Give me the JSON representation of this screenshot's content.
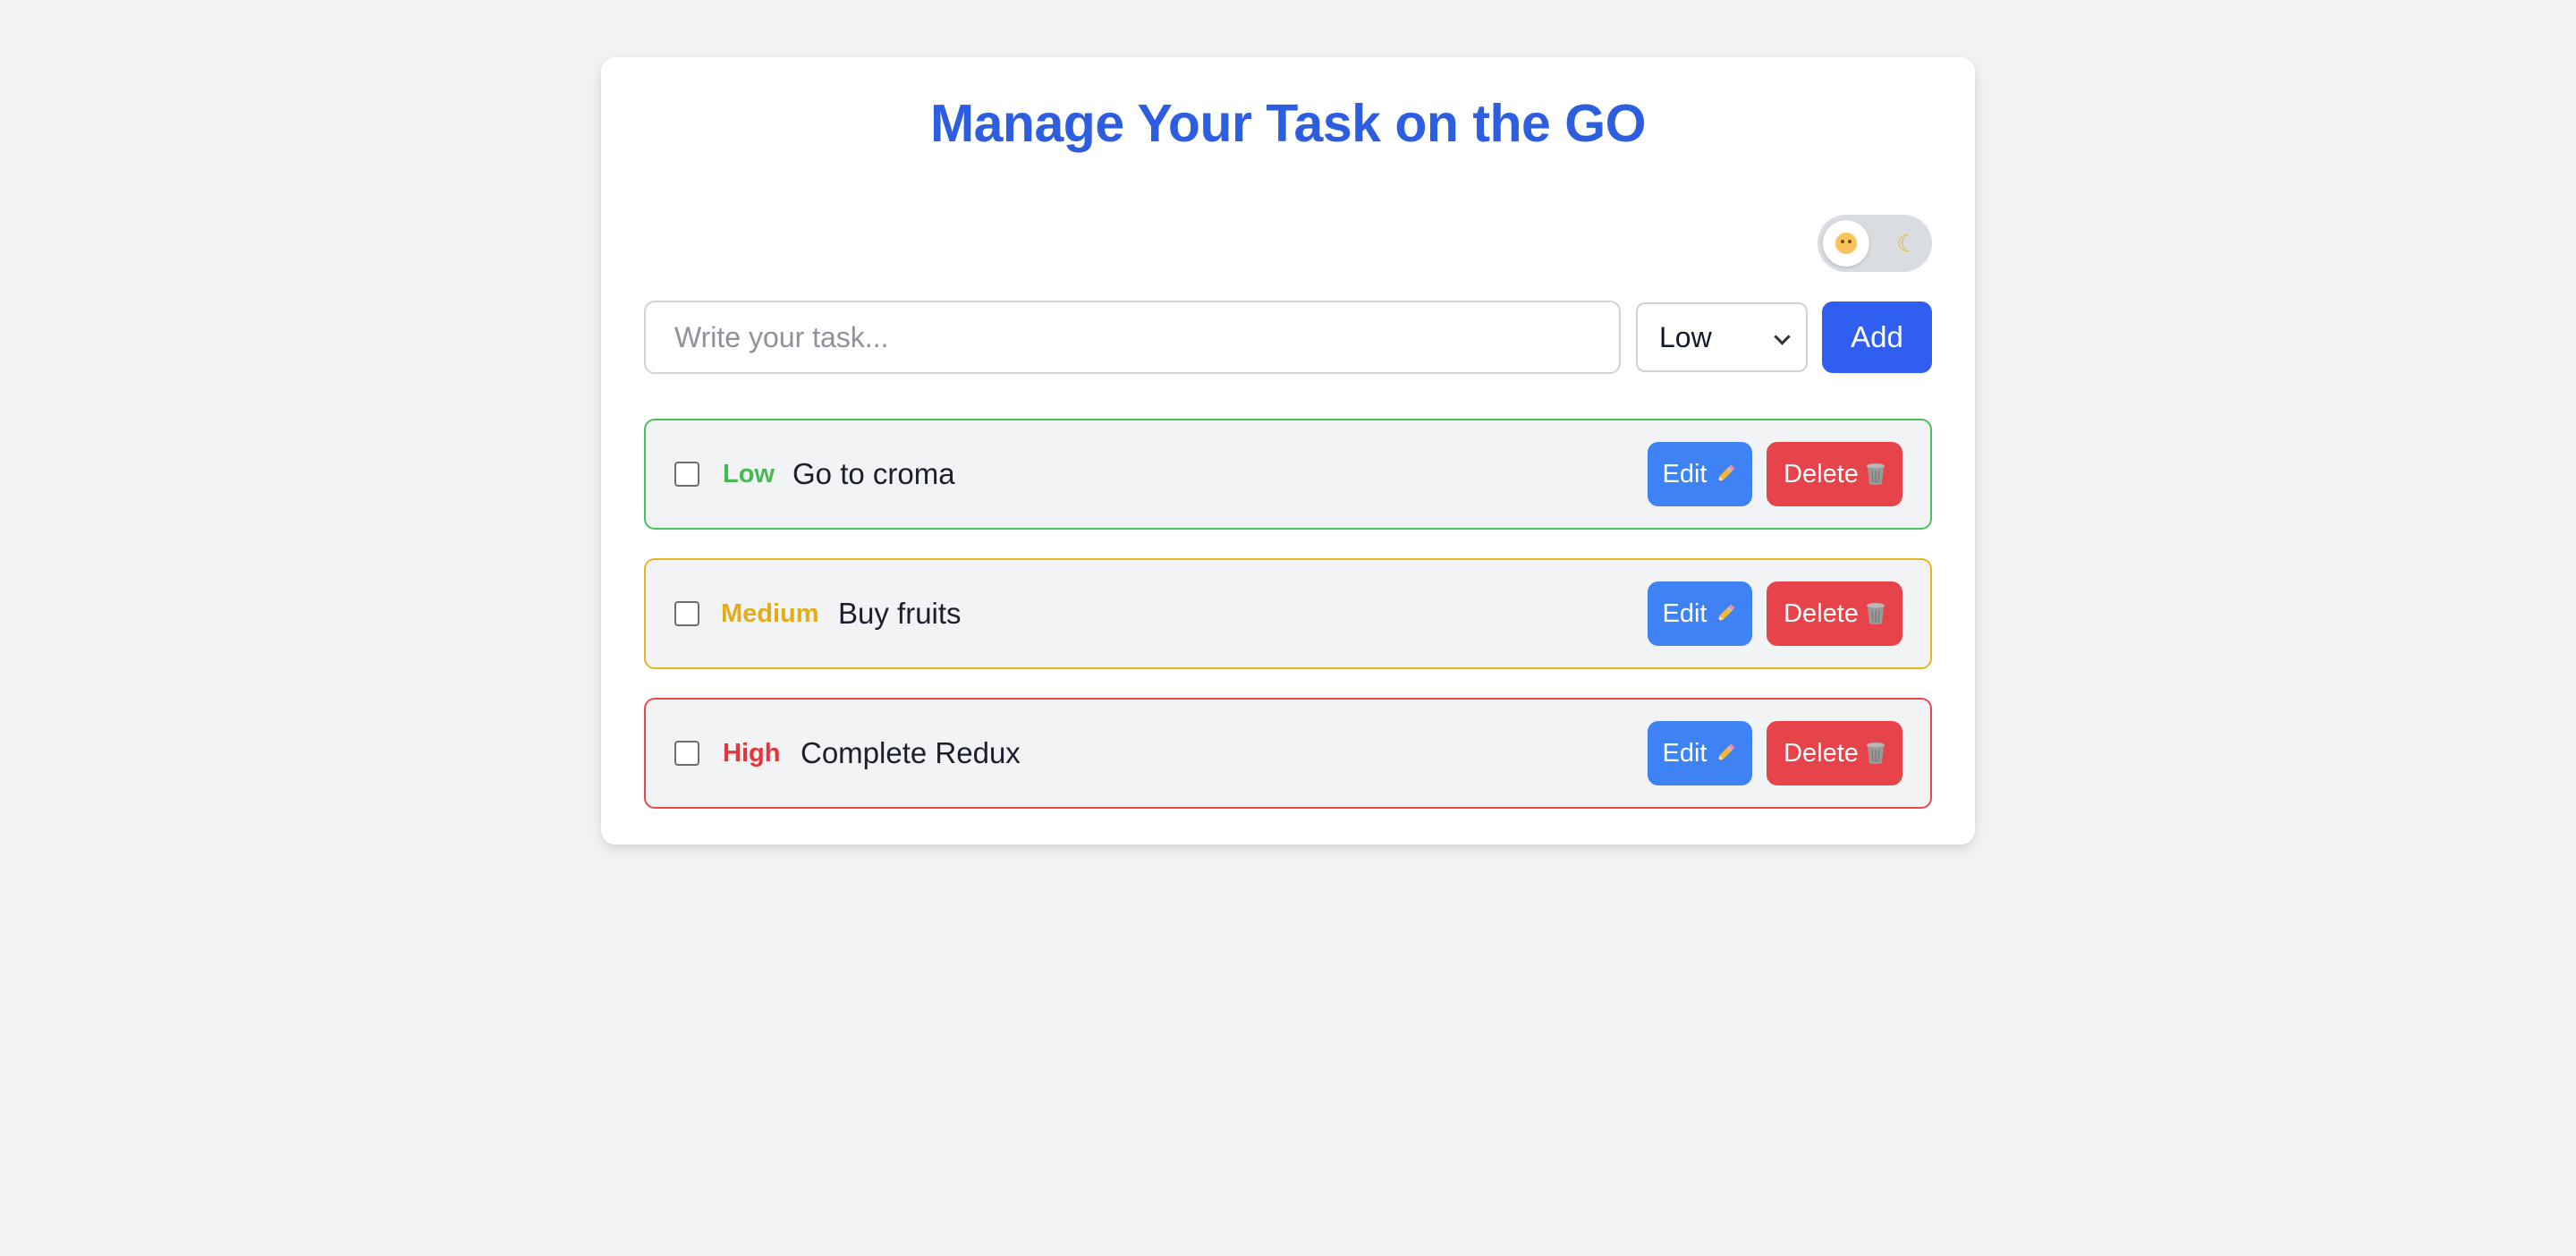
{
  "app": {
    "title": "Manage Your Task on the GO"
  },
  "theme_toggle": {
    "light_icon": "sun-face-icon",
    "dark_icon": "moon-icon",
    "moon_glyph": "☾"
  },
  "new_task": {
    "placeholder": "Write your task...",
    "value": "",
    "priority_selected": "Low",
    "add_label": "Add"
  },
  "tasks": [
    {
      "priority": "Low",
      "text": "Go to croma",
      "done": false,
      "edit_label": "Edit",
      "delete_label": "Delete",
      "color": "#4ac15f"
    },
    {
      "priority": "Medium",
      "text": "Buy fruits",
      "done": false,
      "edit_label": "Edit",
      "delete_label": "Delete",
      "color": "#eab423"
    },
    {
      "priority": "High",
      "text": "Complete Redux",
      "done": false,
      "edit_label": "Edit",
      "delete_label": "Delete",
      "color": "#e8474e"
    }
  ],
  "colors": {
    "title": "#2e5ee0",
    "add_button": "#2f5ef0",
    "edit_button": "#3f82f4",
    "delete_button": "#e6444a",
    "background": "#f2f3f5"
  },
  "icons": {
    "edit": "pencil-icon",
    "delete": "trash-icon"
  }
}
